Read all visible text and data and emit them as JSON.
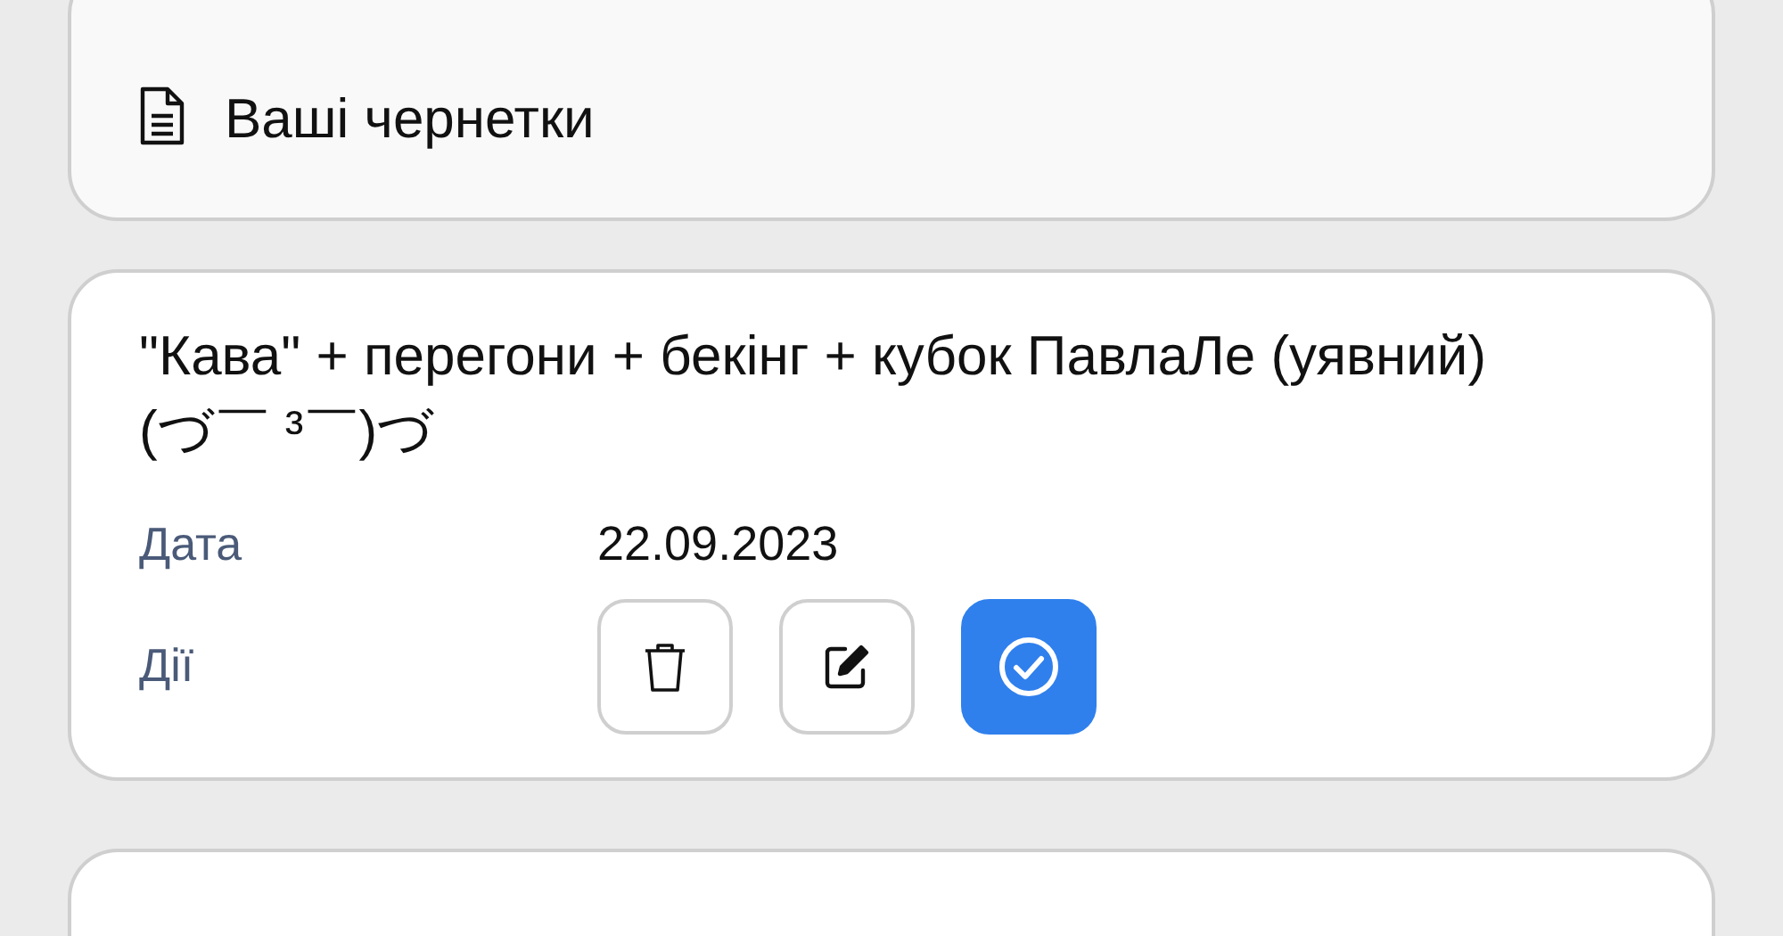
{
  "drafts_header": {
    "title": "Ваші чернетки"
  },
  "draft": {
    "title": "\"Кава\" + перегони + бекінг + кубок ПавлаЛе (уявний) (づ￣ ³￣)づ",
    "date_label": "Дата",
    "date": "22.09.2023",
    "actions_label": "Дії",
    "actions": [
      {
        "kind": "delete"
      },
      {
        "kind": "edit"
      },
      {
        "kind": "publish"
      }
    ]
  }
}
